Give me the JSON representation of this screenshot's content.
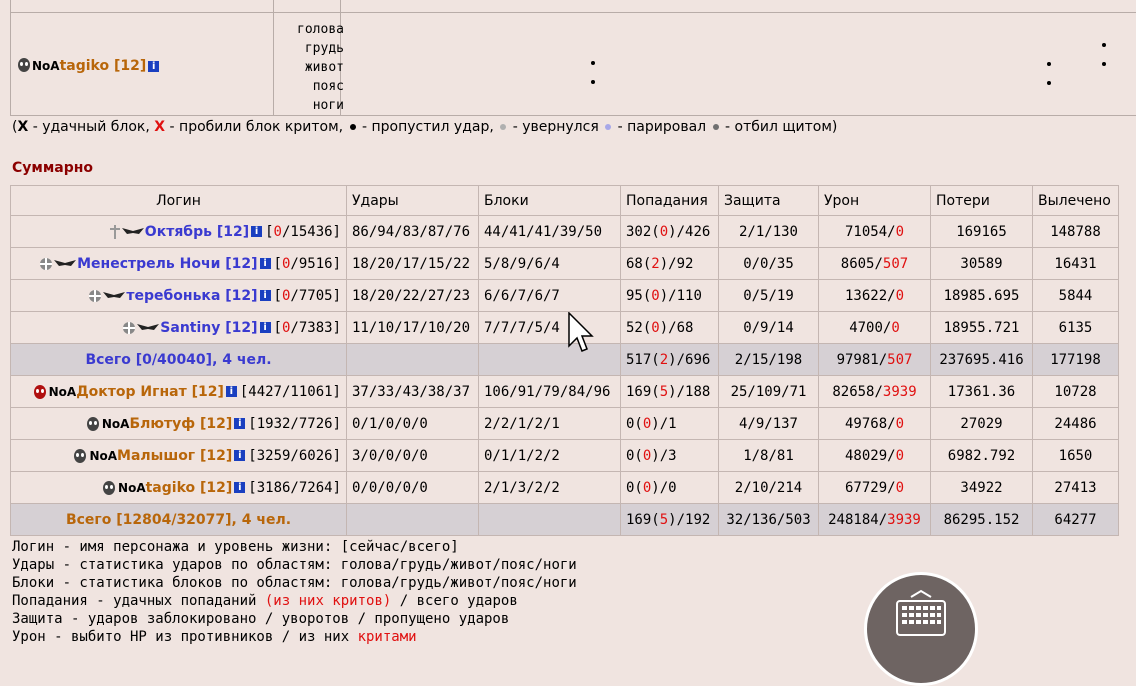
{
  "top": {
    "zones": [
      "голова",
      "грудь",
      "живот",
      "пояс",
      "ноги"
    ],
    "fighter": {
      "clan": "NoA",
      "name": "tagiko",
      "level": "[12]"
    }
  },
  "legend": {
    "open": "(",
    "x_black": "X",
    "t1": " - удачный блок, ",
    "x_red": "X",
    "t2": " - пробили блок критом, ",
    "t3": " - пропустил удар, ",
    "t4": " - увернулся ",
    "t5": " - парировал ",
    "t6": " - отбил щитом)",
    "colors": {
      "missed": "#000000",
      "dodged": "#b0b0b0",
      "parried": "#a8a8e8",
      "shield": "#707070"
    }
  },
  "summary": {
    "title": "Суммарно",
    "headers": [
      "Логин",
      "Удары",
      "Блоки",
      "Попадания",
      "Защита",
      "Урон",
      "Потери",
      "Вылечено"
    ],
    "team_a": [
      {
        "name": "Октябрь",
        "level": "[12]",
        "hp_cur": "0",
        "hp_max": "/15436]",
        "hits": "86/94/83/87/76",
        "blocks": "44/41/41/39/50",
        "acc_a": "302(",
        "acc_crit": "0",
        "acc_b": ")/426",
        "def": "2/1/130",
        "dmg": "71054/",
        "dmg_crit": "0",
        "loss": "169165",
        "healed": "148788"
      },
      {
        "name": "Менестрель Ночи",
        "level": "[12]",
        "hp_cur": "0",
        "hp_max": "/9516]",
        "hits": "18/20/17/15/22",
        "blocks": "5/8/9/6/4",
        "acc_a": "68(",
        "acc_crit": "2",
        "acc_b": ")/92",
        "def": "0/0/35",
        "dmg": "8605/",
        "dmg_crit": "507",
        "loss": "30589",
        "healed": "16431"
      },
      {
        "name": "теребонька",
        "level": "[12]",
        "hp_cur": "0",
        "hp_max": "/7705]",
        "hits": "18/20/22/27/23",
        "blocks": "6/6/7/6/7",
        "acc_a": "95(",
        "acc_crit": "0",
        "acc_b": ")/110",
        "def": "0/5/19",
        "dmg": "13622/",
        "dmg_crit": "0",
        "loss": "18985.695",
        "healed": "5844"
      },
      {
        "name": "Santiny",
        "level": "[12]",
        "hp_cur": "0",
        "hp_max": "/7383]",
        "hits": "11/10/17/10/20",
        "blocks": "7/7/7/5/4",
        "acc_a": "52(",
        "acc_crit": "0",
        "acc_b": ")/68",
        "def": "0/9/14",
        "dmg": "4700/",
        "dmg_crit": "0",
        "loss": "18955.721",
        "healed": "6135"
      }
    ],
    "total_a": {
      "label": "Всего [0/40040], 4 чел.",
      "acc_a": "517(",
      "acc_crit": "2",
      "acc_b": ")/696",
      "def": "2/15/198",
      "dmg": "97981/",
      "dmg_crit": "507",
      "loss": "237695.416",
      "healed": "177198"
    },
    "team_b": [
      {
        "clan": "NoA",
        "name": "Доктор Игнат",
        "level": "[12]",
        "hp": "[4427/11061]",
        "hits": "37/33/43/38/37",
        "blocks": "106/91/79/84/96",
        "acc_a": "169(",
        "acc_crit": "5",
        "acc_b": ")/188",
        "def": "25/109/71",
        "dmg": "82658/",
        "dmg_crit": "3939",
        "loss": "17361.36",
        "healed": "10728"
      },
      {
        "clan": "NoA",
        "name": "Блютуф",
        "level": "[12]",
        "hp": "[1932/7726]",
        "hits": "0/1/0/0/0",
        "blocks": "2/2/1/2/1",
        "acc_a": "0(",
        "acc_crit": "0",
        "acc_b": ")/1",
        "def": "4/9/137",
        "dmg": "49768/",
        "dmg_crit": "0",
        "loss": "27029",
        "healed": "24486"
      },
      {
        "clan": "NoA",
        "name": "Малышог",
        "level": "[12]",
        "hp": "[3259/6026]",
        "hits": "3/0/0/0/0",
        "blocks": "0/1/1/2/2",
        "acc_a": "0(",
        "acc_crit": "0",
        "acc_b": ")/3",
        "def": "1/8/81",
        "dmg": "48029/",
        "dmg_crit": "0",
        "loss": "6982.792",
        "healed": "1650"
      },
      {
        "clan": "NoA",
        "name": "tagiko",
        "level": "[12]",
        "hp": "[3186/7264]",
        "hits": "0/0/0/0/0",
        "blocks": "2/1/3/2/2",
        "acc_a": "0(",
        "acc_crit": "0",
        "acc_b": ")/0",
        "def": "2/10/214",
        "dmg": "67729/",
        "dmg_crit": "0",
        "loss": "34922",
        "healed": "27413"
      }
    ],
    "total_b": {
      "label": "Всего [12804/32077], 4 чел.",
      "acc_a": "169(",
      "acc_crit": "5",
      "acc_b": ")/192",
      "def": "32/136/503",
      "dmg": "248184/",
      "dmg_crit": "3939",
      "loss": "86295.152",
      "healed": "64277"
    }
  },
  "notes": {
    "login": "Логин - имя персонажа и уровень жизни: [сейчас/всего]",
    "hits": "Удары - статистика ударов по областям: голова/грудь/живот/пояс/ноги",
    "blocks": "Блоки - статистика блоков по областям: голова/грудь/живот/пояс/ноги",
    "acc_a": "Попадания - удачных попаданий ",
    "acc_red": "(из них критов)",
    "acc_b": " / всего ударов",
    "def": "Защита - ударов заблокировано / уворотов / пропущено ударов",
    "dmg_a": "Урон - выбито HP из противников / из них ",
    "dmg_red": "критами"
  }
}
